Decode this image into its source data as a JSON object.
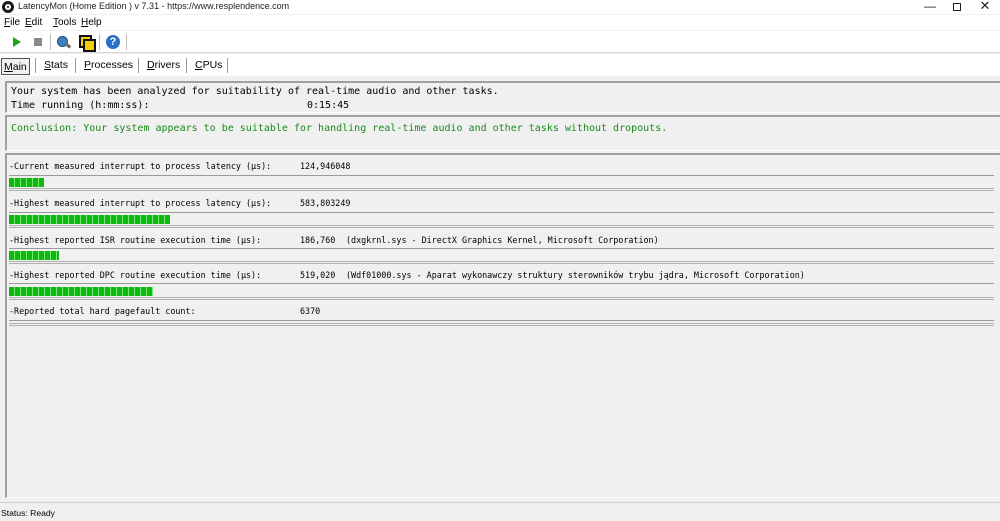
{
  "window": {
    "title": "LatencyMon  (Home Edition )  v 7.31 - https://www.resplendence.com",
    "minimize": "—",
    "close": "✕"
  },
  "menu": [
    "File",
    "Edit",
    "Tools",
    "Help"
  ],
  "toolbar": {
    "icons": [
      "play-icon",
      "stop-icon",
      "analyze-icon",
      "windows-icon",
      "help-icon"
    ]
  },
  "tabs": [
    "Main",
    "Stats",
    "Processes",
    "Drivers",
    "CPUs"
  ],
  "active_tab": "Main",
  "summary": {
    "line1": "Your system has been analyzed for suitability of real-time audio and other tasks.",
    "time_label": "Time running (h:mm:ss):",
    "time_value": "0:15:45"
  },
  "conclusion": {
    "text": "Conclusion: Your system appears to be suitable for handling real-time audio and other tasks without dropouts.",
    "color": "#1a8a1a"
  },
  "metrics": [
    {
      "label": "-Current measured interrupt to process latency (µs):",
      "value": "124,946048",
      "detail": "",
      "meter_fraction": 0.036
    },
    {
      "label": "-Highest measured interrupt to process latency (µs):",
      "value": "583,803249",
      "detail": "",
      "meter_fraction": 0.163
    },
    {
      "label": "-Highest reported ISR routine execution time (µs):",
      "value": "186,760",
      "detail": "(dxgkrnl.sys - DirectX Graphics Kernel, Microsoft Corporation)",
      "meter_fraction": 0.051
    },
    {
      "label": "-Highest reported DPC routine execution time (µs):",
      "value": "519,020",
      "detail": "(Wdf01000.sys - Aparat wykonawczy struktury sterowników trybu jądra, Microsoft Corporation)",
      "meter_fraction": 0.146
    },
    {
      "label": "-Reported total hard pagefault count:",
      "value": "6370",
      "detail": ""
    }
  ],
  "meter_color": "#0fb80f",
  "status": "Status: Ready"
}
